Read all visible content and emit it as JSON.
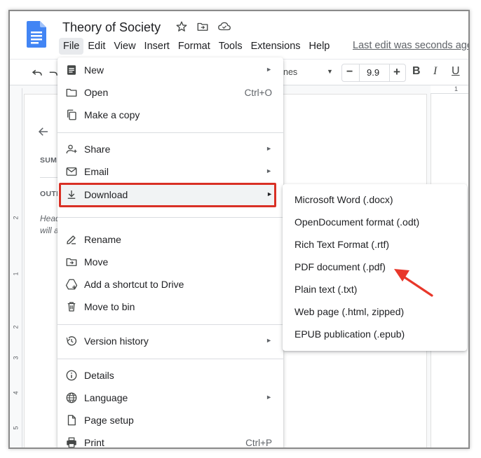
{
  "document": {
    "title": "Theory of Society"
  },
  "menubar": {
    "items": [
      {
        "label": "File"
      },
      {
        "label": "Edit"
      },
      {
        "label": "View"
      },
      {
        "label": "Insert"
      },
      {
        "label": "Format"
      },
      {
        "label": "Tools"
      },
      {
        "label": "Extensions"
      },
      {
        "label": "Help"
      }
    ],
    "last_edit": "Last edit was seconds ago"
  },
  "toolbar": {
    "font_name_partial": "nes",
    "font_size": "9.9",
    "minus": "−",
    "plus": "+",
    "bold": "B",
    "italic": "I",
    "underline": "U"
  },
  "outline_panel": {
    "summary_label": "SUM",
    "outline_label": "OUTL",
    "hint_line1": "Head",
    "hint_line2": "will a"
  },
  "ruler": {
    "top_marks": [
      "1"
    ],
    "left_marks": [
      "2",
      "1",
      "2",
      "3",
      "4",
      "5"
    ]
  },
  "file_menu": {
    "items": [
      {
        "label": "New",
        "shortcut": "",
        "submenu": true,
        "icon": "new-doc-icon"
      },
      {
        "label": "Open",
        "shortcut": "Ctrl+O",
        "submenu": false,
        "icon": "folder-icon"
      },
      {
        "label": "Make a copy",
        "shortcut": "",
        "submenu": false,
        "icon": "copy-icon"
      },
      {
        "label": "Share",
        "shortcut": "",
        "submenu": true,
        "icon": "person-add-icon"
      },
      {
        "label": "Email",
        "shortcut": "",
        "submenu": true,
        "icon": "email-icon"
      },
      {
        "label": "Download",
        "shortcut": "",
        "submenu": true,
        "icon": "download-icon"
      },
      {
        "label": "Rename",
        "shortcut": "",
        "submenu": false,
        "icon": "rename-icon"
      },
      {
        "label": "Move",
        "shortcut": "",
        "submenu": false,
        "icon": "move-icon"
      },
      {
        "label": "Add a shortcut to Drive",
        "shortcut": "",
        "submenu": false,
        "icon": "drive-shortcut-icon"
      },
      {
        "label": "Move to bin",
        "shortcut": "",
        "submenu": false,
        "icon": "trash-icon"
      },
      {
        "label": "Version history",
        "shortcut": "",
        "submenu": true,
        "icon": "history-icon"
      },
      {
        "label": "Details",
        "shortcut": "",
        "submenu": false,
        "icon": "info-icon"
      },
      {
        "label": "Language",
        "shortcut": "",
        "submenu": true,
        "icon": "globe-icon"
      },
      {
        "label": "Page setup",
        "shortcut": "",
        "submenu": false,
        "icon": "page-setup-icon"
      },
      {
        "label": "Print",
        "shortcut": "Ctrl+P",
        "submenu": false,
        "icon": "print-icon"
      }
    ],
    "arrow_glyph": "►"
  },
  "download_menu": {
    "items": [
      {
        "label": "Microsoft Word (.docx)"
      },
      {
        "label": "OpenDocument format (.odt)"
      },
      {
        "label": "Rich Text Format (.rtf)"
      },
      {
        "label": "PDF document (.pdf)"
      },
      {
        "label": "Plain text (.txt)"
      },
      {
        "label": "Web page (.html, zipped)"
      },
      {
        "label": "EPUB publication (.epub)"
      }
    ]
  },
  "colors": {
    "docs_blue": "#4285f4",
    "highlight_red": "#d93025",
    "arrow_red": "#e8372a",
    "text": "#202124",
    "muted": "#5f6368"
  }
}
